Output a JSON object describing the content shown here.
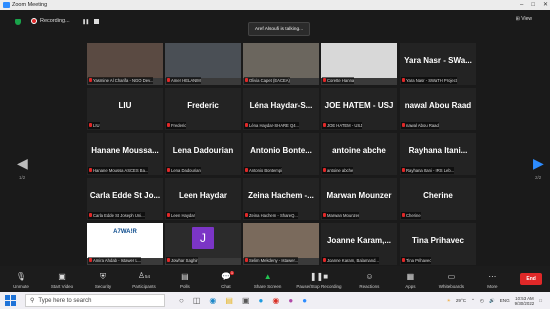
{
  "window": {
    "title": "Zoom Meeting",
    "minimize": "–",
    "maximize": "□",
    "close": "✕"
  },
  "meeting": {
    "recording_label": "Recording...",
    "talking": "Aref Alsoufi is talking...",
    "view_label": "⊞ View"
  },
  "participants": [
    {
      "big": "",
      "label": "Yasmine Al Charifa - NGO Dev...",
      "video": true,
      "bg": "#5a4a42"
    },
    {
      "big": "",
      "label": "Amer HELANIM",
      "video": true,
      "bg": "#4a4f55"
    },
    {
      "big": "",
      "label": "Olivia Capet (EACEA)",
      "video": true,
      "bg": "#6b665e"
    },
    {
      "big": "",
      "label": "Corette Hanna",
      "video": true,
      "bg": "#d8d8d8"
    },
    {
      "big": "Yara Nasr - SWa...",
      "label": "Yara Nasr - SWaTH Project",
      "video": false
    },
    {
      "big": "LIU",
      "label": "LIU",
      "video": false
    },
    {
      "big": "Frederic",
      "label": "Frederic",
      "video": false
    },
    {
      "big": "Léna Haydar-S...",
      "label": "Léna Haydar-SHARE Q4...",
      "video": false
    },
    {
      "big": "JOE HATEM - USJ",
      "label": "JOE HATEM - USJ",
      "video": false
    },
    {
      "big": "nawal Abou Raad",
      "label": "nawal Abou Raad",
      "video": false
    },
    {
      "big": "Hanane Moussa...",
      "label": "Hanane Moussa ASCES Ba...",
      "video": false
    },
    {
      "big": "Lena Dadourian",
      "label": "Lena Dadourian",
      "video": false
    },
    {
      "big": "Antonio Bonte...",
      "label": "Antonio Bontempi",
      "video": false
    },
    {
      "big": "antoine abche",
      "label": "antoine abche",
      "video": false
    },
    {
      "big": "Rayhana Itani...",
      "label": "Rayhana Itani - IRS Leb...",
      "video": false
    },
    {
      "big": "Carla Edde St Jo...",
      "label": "Carla Edde St Joseph Uni...",
      "video": false
    },
    {
      "big": "Leen Haydar",
      "label": "Leen Haydar",
      "video": false
    },
    {
      "big": "Zeina Hachem -...",
      "label": "Zeina Hachem - ShareQ...",
      "video": false
    },
    {
      "big": "Marwan Mounzer",
      "label": "Marwan Mounzer",
      "video": false
    },
    {
      "big": "Cherine",
      "label": "Cherine",
      "video": false
    },
    {
      "big": "",
      "label": "Amira Ahdab - Istawer L...",
      "video": true,
      "bg": "#ffffff",
      "logo": "A7WA!R"
    },
    {
      "big": "",
      "label": "Jowhar Saghir",
      "video": true,
      "bg": "#2b2b2b",
      "avatar": "J"
    },
    {
      "big": "",
      "label": "Selim Mekdeny - Istawer...",
      "video": true,
      "bg": "#7a6a5c"
    },
    {
      "big": "Joanne Karam,...",
      "label": "Joanne Karam, Balamand...",
      "video": false
    },
    {
      "big": "Tina Prihavec",
      "label": "Tina Prihavec",
      "video": false
    }
  ],
  "pager": {
    "left": "1/2",
    "right": "2/2"
  },
  "toolbar": {
    "unmute": "Unmute",
    "video": "Start Video",
    "security": "Security",
    "participants": "Participants",
    "participants_count": "54",
    "polls": "Polls",
    "chat": "Chat",
    "chat_badge": "1",
    "share": "Share Screen",
    "record": "Pause/Stop Recording",
    "reactions": "Reactions",
    "apps": "Apps",
    "whiteboards": "Whiteboards",
    "more": "More",
    "end": "End"
  },
  "taskbar": {
    "search_placeholder": "Type here to search",
    "temp": "29°C",
    "lang": "ENG",
    "time": "10:53 AM",
    "date": "9/30/2022"
  },
  "colors": {
    "accent_green": "#23c552",
    "record_red": "#e02828",
    "zoom_blue": "#2d8cff"
  }
}
